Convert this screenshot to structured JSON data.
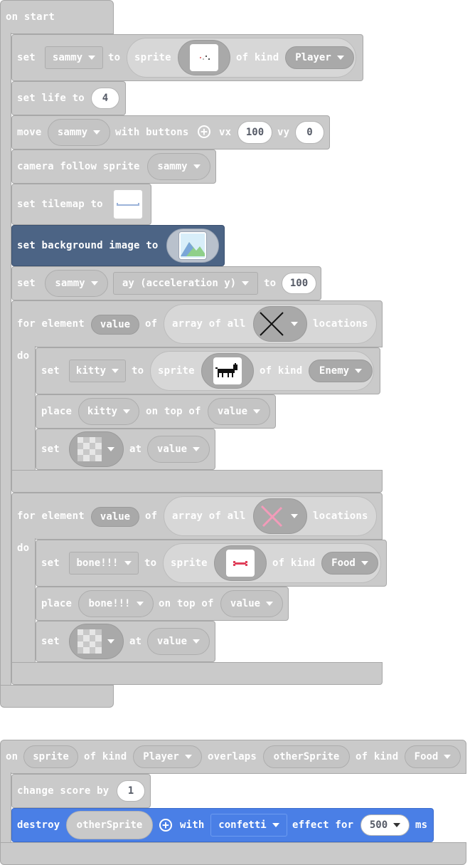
{
  "on_start": {
    "hat": "on start",
    "set_sammy": {
      "set": "set",
      "var": "sammy",
      "to": "to",
      "sprite": "sprite",
      "of_kind": "of kind",
      "kind": "Player"
    },
    "set_life": {
      "text": "set life to",
      "value": "4"
    },
    "move": {
      "move": "move",
      "var": "sammy",
      "with_buttons": "with buttons",
      "vx_label": "vx",
      "vx": "100",
      "vy_label": "vy",
      "vy": "0"
    },
    "camera": {
      "text": "camera follow sprite",
      "var": "sammy"
    },
    "tilemap": {
      "text": "set tilemap to"
    },
    "background": {
      "text": "set background image to"
    },
    "set_ay": {
      "set": "set",
      "var": "sammy",
      "prop": "ay (acceleration y)",
      "to": "to",
      "value": "100"
    },
    "loop1": {
      "for_element": "for element",
      "value": "value",
      "of": "of",
      "array_of_all": "array of all",
      "locations": "locations",
      "do": "do",
      "set_kitty": {
        "set": "set",
        "var": "kitty",
        "to": "to",
        "sprite": "sprite",
        "of_kind": "of kind",
        "kind": "Enemy"
      },
      "place": {
        "place": "place",
        "var": "kitty",
        "on_top_of": "on top of",
        "value": "value"
      },
      "set_tile": {
        "set": "set",
        "at": "at",
        "value": "value"
      }
    },
    "loop2": {
      "for_element": "for element",
      "value": "value",
      "of": "of",
      "array_of_all": "array of all",
      "locations": "locations",
      "do": "do",
      "set_bone": {
        "set": "set",
        "var": "bone!!!",
        "to": "to",
        "sprite": "sprite",
        "of_kind": "of kind",
        "kind": "Food"
      },
      "place": {
        "place": "place",
        "var": "bone!!!",
        "on_top_of": "on top of",
        "value": "value"
      },
      "set_tile": {
        "set": "set",
        "at": "at",
        "value": "value"
      }
    }
  },
  "overlap": {
    "on": "on",
    "sprite": "sprite",
    "of_kind": "of kind",
    "kind1": "Player",
    "overlaps": "overlaps",
    "other": "otherSprite",
    "of_kind2": "of kind",
    "kind2": "Food",
    "change_score": {
      "text": "change score by",
      "value": "1"
    },
    "destroy": {
      "destroy": "destroy",
      "target": "otherSprite",
      "with": "with",
      "effect": "confetti",
      "effect_for": "effect for",
      "ms_value": "500",
      "ms": "ms"
    }
  },
  "colors": {
    "block_gray": "#cacaca",
    "highlight": "#4c6485",
    "destroy_blue": "#4a7fe6"
  }
}
